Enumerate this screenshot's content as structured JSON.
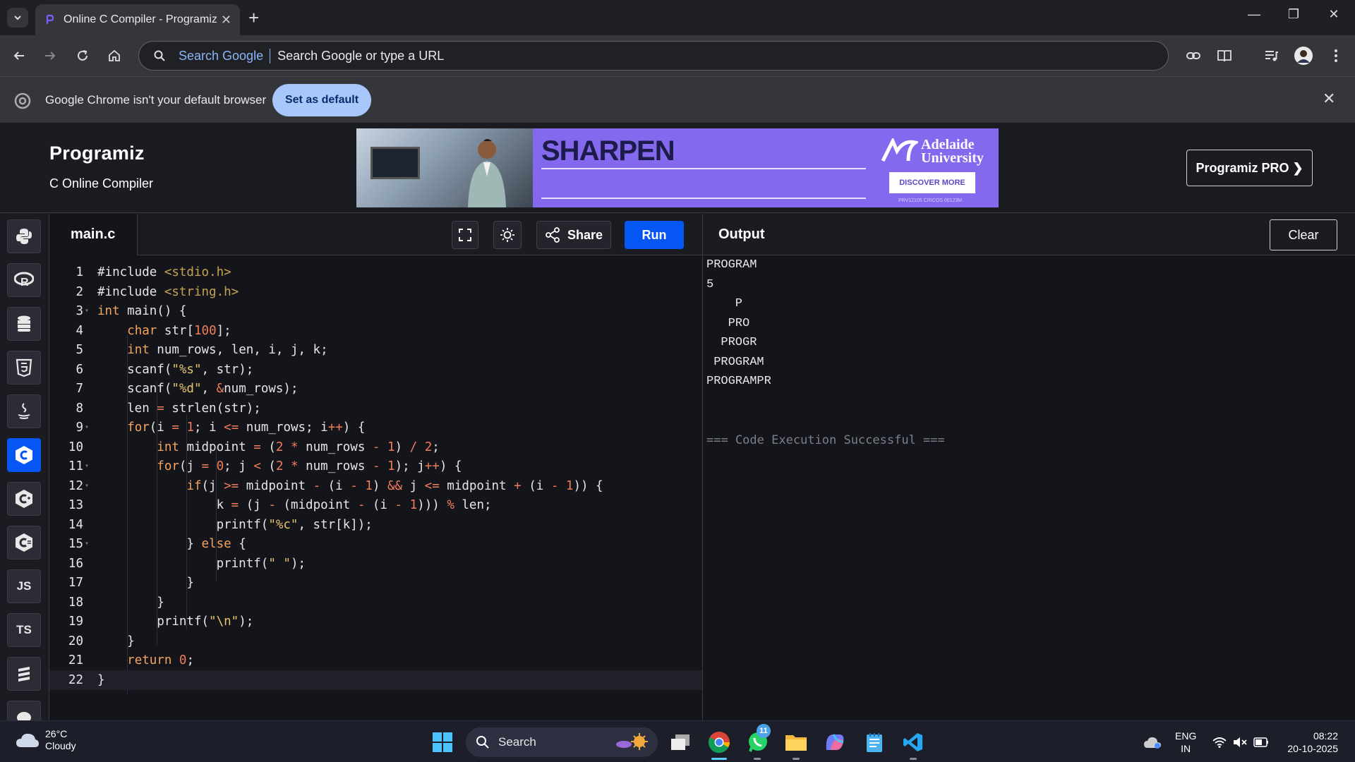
{
  "browser": {
    "tab_title": "Online C Compiler - Programiz",
    "tab_close": "✕",
    "new_tab": "+",
    "window_controls": [
      "—",
      "❐",
      "✕"
    ],
    "omnibox_chip": "Search Google",
    "omnibox_placeholder": "Search Google or type a URL",
    "infobar_message": "Google Chrome isn't your default browser",
    "infobar_button": "Set as default",
    "infobar_close": "✕"
  },
  "site": {
    "logo": "Programiz",
    "subtitle": "C Online Compiler",
    "pro_button": "Programiz PRO ❯",
    "ad": {
      "headline": "SHARPEN",
      "university_line1": "Adelaide",
      "university_line2": "University",
      "cta": "DISCOVER MORE",
      "fineprint": "PRV12105 CRICOS 00123M"
    }
  },
  "rail": {
    "languages": [
      "python",
      "r",
      "sql",
      "html",
      "java",
      "c",
      "c++",
      "c#",
      "JS",
      "TS",
      "go",
      "php"
    ],
    "active": "c"
  },
  "editor": {
    "filename": "main.c",
    "share_label": "Share",
    "run_label": "Run",
    "line_numbers": [
      "1",
      "2",
      "3",
      "4",
      "5",
      "6",
      "7",
      "8",
      "9",
      "10",
      "11",
      "12",
      "13",
      "14",
      "15",
      "16",
      "17",
      "18",
      "19",
      "20",
      "21",
      "22"
    ],
    "code_lines": [
      "#include <stdio.h>",
      "#include <string.h>",
      "int main() {",
      "    char str[100];",
      "    int num_rows, len, i, j, k;",
      "    scanf(\"%s\", str);",
      "    scanf(\"%d\", &num_rows);",
      "    len = strlen(str);",
      "    for(i = 1; i <= num_rows; i++) {",
      "        int midpoint = (2 * num_rows - 1) / 2;",
      "        for(j = 0; j < (2 * num_rows - 1); j++) {",
      "            if(j >= midpoint - (i - 1) && j <= midpoint + (i - 1)) {",
      "                k = (j - (midpoint - (i - 1))) % len;",
      "                printf(\"%c\", str[k]);",
      "            } else {",
      "                printf(\" \");",
      "            }",
      "        }",
      "        printf(\"\\n\");",
      "    }",
      "    return 0;",
      "}"
    ]
  },
  "output": {
    "title": "Output",
    "clear_label": "Clear",
    "lines": [
      "PROGRAM",
      "5",
      "    P",
      "   PRO",
      "  PROGR",
      " PROGRAM",
      "PROGRAMPR",
      "",
      "",
      "=== Code Execution Successful ==="
    ]
  },
  "taskbar": {
    "temperature": "26°C",
    "condition": "Cloudy",
    "search_label": "Search",
    "whatsapp_badge": "11",
    "language": "ENG",
    "region": "IN",
    "time": "08:22",
    "date": "20-10-2025"
  },
  "colors": {
    "accent": "#0556f3",
    "editor_bg": "#14151b",
    "keyword": "#f5a45d",
    "string": "#e8c46a",
    "number": "#f07c5a"
  }
}
